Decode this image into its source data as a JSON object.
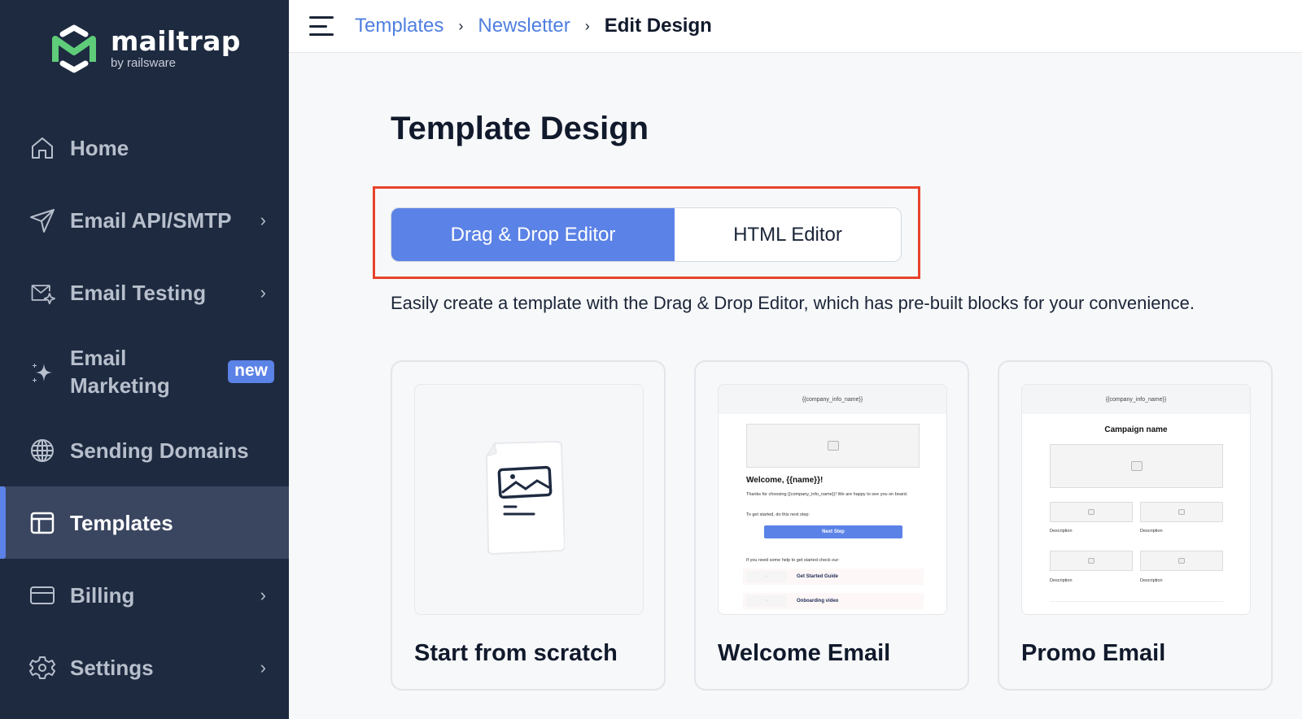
{
  "brand": {
    "name": "mailtrap",
    "subtitle": "by railsware",
    "colors": {
      "sidebar_bg": "#1e2a40",
      "accent": "#5b82e6",
      "logo_green": "#5fcc7a",
      "highlight": "#e8432b"
    }
  },
  "sidebar": {
    "items": [
      {
        "label": "Home",
        "icon": "home-icon",
        "has_chevron": false,
        "active": false
      },
      {
        "label": "Email API/SMTP",
        "icon": "send-icon",
        "has_chevron": true,
        "active": false
      },
      {
        "label": "Email Testing",
        "icon": "email-testing-icon",
        "has_chevron": true,
        "active": false
      },
      {
        "label": "Email Marketing",
        "label_line1": "Email",
        "label_line2": "Marketing",
        "icon": "sparkle-icon",
        "badge": "new",
        "active": false
      },
      {
        "label": "Sending Domains",
        "icon": "globe-icon",
        "has_chevron": false,
        "active": false
      },
      {
        "label": "Templates",
        "icon": "templates-icon",
        "has_chevron": false,
        "active": true
      },
      {
        "label": "Billing",
        "icon": "credit-card-icon",
        "has_chevron": true,
        "active": false
      },
      {
        "label": "Settings",
        "icon": "gear-icon",
        "has_chevron": true,
        "active": false
      }
    ],
    "chevron": "›"
  },
  "topbar": {
    "breadcrumb": [
      {
        "label": "Templates",
        "link": true
      },
      {
        "label": "Newsletter",
        "link": true
      },
      {
        "label": "Edit Design",
        "link": false
      }
    ],
    "separator": "›"
  },
  "main": {
    "title": "Template Design",
    "editor_toggle": {
      "options": [
        {
          "label": "Drag & Drop Editor",
          "selected": true
        },
        {
          "label": "HTML Editor",
          "selected": false
        }
      ]
    },
    "description": "Easily create a template with the Drag & Drop Editor, which has pre-built blocks for your convenience.",
    "cards": [
      {
        "title": "Start from scratch"
      },
      {
        "title": "Welcome Email",
        "preview": {
          "header": "{{company_info_name}}",
          "heading": "Welcome, {{name}}!",
          "paragraph": "Thanks for choosing {{company_info_name}}! We are happy to see you on board.",
          "step_text": "To get started, do this next step:",
          "button": "Next Step",
          "help_text": "If you need some help to get started check our:",
          "links": [
            "Get Started Guide",
            "Onboarding video"
          ]
        }
      },
      {
        "title": "Promo Email",
        "preview": {
          "header": "{{company_info_name}}",
          "heading": "Campaign name",
          "descriptions": [
            "Description",
            "Description",
            "Description",
            "Description"
          ]
        }
      }
    ]
  }
}
